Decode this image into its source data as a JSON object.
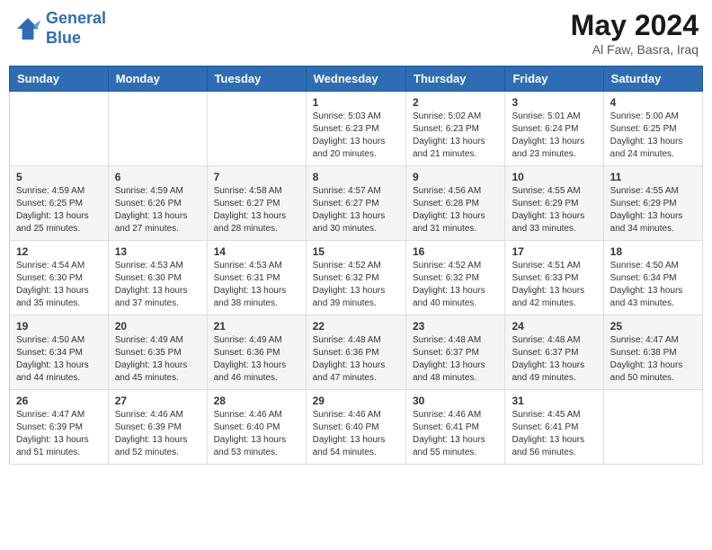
{
  "header": {
    "logo_line1": "General",
    "logo_line2": "Blue",
    "main_title": "May 2024",
    "subtitle": "Al Faw, Basra, Iraq"
  },
  "calendar": {
    "days_of_week": [
      "Sunday",
      "Monday",
      "Tuesday",
      "Wednesday",
      "Thursday",
      "Friday",
      "Saturday"
    ],
    "weeks": [
      [
        {
          "day": "",
          "info": ""
        },
        {
          "day": "",
          "info": ""
        },
        {
          "day": "",
          "info": ""
        },
        {
          "day": "1",
          "info": "Sunrise: 5:03 AM\nSunset: 6:23 PM\nDaylight: 13 hours\nand 20 minutes."
        },
        {
          "day": "2",
          "info": "Sunrise: 5:02 AM\nSunset: 6:23 PM\nDaylight: 13 hours\nand 21 minutes."
        },
        {
          "day": "3",
          "info": "Sunrise: 5:01 AM\nSunset: 6:24 PM\nDaylight: 13 hours\nand 23 minutes."
        },
        {
          "day": "4",
          "info": "Sunrise: 5:00 AM\nSunset: 6:25 PM\nDaylight: 13 hours\nand 24 minutes."
        }
      ],
      [
        {
          "day": "5",
          "info": "Sunrise: 4:59 AM\nSunset: 6:25 PM\nDaylight: 13 hours\nand 25 minutes."
        },
        {
          "day": "6",
          "info": "Sunrise: 4:59 AM\nSunset: 6:26 PM\nDaylight: 13 hours\nand 27 minutes."
        },
        {
          "day": "7",
          "info": "Sunrise: 4:58 AM\nSunset: 6:27 PM\nDaylight: 13 hours\nand 28 minutes."
        },
        {
          "day": "8",
          "info": "Sunrise: 4:57 AM\nSunset: 6:27 PM\nDaylight: 13 hours\nand 30 minutes."
        },
        {
          "day": "9",
          "info": "Sunrise: 4:56 AM\nSunset: 6:28 PM\nDaylight: 13 hours\nand 31 minutes."
        },
        {
          "day": "10",
          "info": "Sunrise: 4:55 AM\nSunset: 6:29 PM\nDaylight: 13 hours\nand 33 minutes."
        },
        {
          "day": "11",
          "info": "Sunrise: 4:55 AM\nSunset: 6:29 PM\nDaylight: 13 hours\nand 34 minutes."
        }
      ],
      [
        {
          "day": "12",
          "info": "Sunrise: 4:54 AM\nSunset: 6:30 PM\nDaylight: 13 hours\nand 35 minutes."
        },
        {
          "day": "13",
          "info": "Sunrise: 4:53 AM\nSunset: 6:30 PM\nDaylight: 13 hours\nand 37 minutes."
        },
        {
          "day": "14",
          "info": "Sunrise: 4:53 AM\nSunset: 6:31 PM\nDaylight: 13 hours\nand 38 minutes."
        },
        {
          "day": "15",
          "info": "Sunrise: 4:52 AM\nSunset: 6:32 PM\nDaylight: 13 hours\nand 39 minutes."
        },
        {
          "day": "16",
          "info": "Sunrise: 4:52 AM\nSunset: 6:32 PM\nDaylight: 13 hours\nand 40 minutes."
        },
        {
          "day": "17",
          "info": "Sunrise: 4:51 AM\nSunset: 6:33 PM\nDaylight: 13 hours\nand 42 minutes."
        },
        {
          "day": "18",
          "info": "Sunrise: 4:50 AM\nSunset: 6:34 PM\nDaylight: 13 hours\nand 43 minutes."
        }
      ],
      [
        {
          "day": "19",
          "info": "Sunrise: 4:50 AM\nSunset: 6:34 PM\nDaylight: 13 hours\nand 44 minutes."
        },
        {
          "day": "20",
          "info": "Sunrise: 4:49 AM\nSunset: 6:35 PM\nDaylight: 13 hours\nand 45 minutes."
        },
        {
          "day": "21",
          "info": "Sunrise: 4:49 AM\nSunset: 6:36 PM\nDaylight: 13 hours\nand 46 minutes."
        },
        {
          "day": "22",
          "info": "Sunrise: 4:48 AM\nSunset: 6:36 PM\nDaylight: 13 hours\nand 47 minutes."
        },
        {
          "day": "23",
          "info": "Sunrise: 4:48 AM\nSunset: 6:37 PM\nDaylight: 13 hours\nand 48 minutes."
        },
        {
          "day": "24",
          "info": "Sunrise: 4:48 AM\nSunset: 6:37 PM\nDaylight: 13 hours\nand 49 minutes."
        },
        {
          "day": "25",
          "info": "Sunrise: 4:47 AM\nSunset: 6:38 PM\nDaylight: 13 hours\nand 50 minutes."
        }
      ],
      [
        {
          "day": "26",
          "info": "Sunrise: 4:47 AM\nSunset: 6:39 PM\nDaylight: 13 hours\nand 51 minutes."
        },
        {
          "day": "27",
          "info": "Sunrise: 4:46 AM\nSunset: 6:39 PM\nDaylight: 13 hours\nand 52 minutes."
        },
        {
          "day": "28",
          "info": "Sunrise: 4:46 AM\nSunset: 6:40 PM\nDaylight: 13 hours\nand 53 minutes."
        },
        {
          "day": "29",
          "info": "Sunrise: 4:46 AM\nSunset: 6:40 PM\nDaylight: 13 hours\nand 54 minutes."
        },
        {
          "day": "30",
          "info": "Sunrise: 4:46 AM\nSunset: 6:41 PM\nDaylight: 13 hours\nand 55 minutes."
        },
        {
          "day": "31",
          "info": "Sunrise: 4:45 AM\nSunset: 6:41 PM\nDaylight: 13 hours\nand 56 minutes."
        },
        {
          "day": "",
          "info": ""
        }
      ]
    ]
  }
}
